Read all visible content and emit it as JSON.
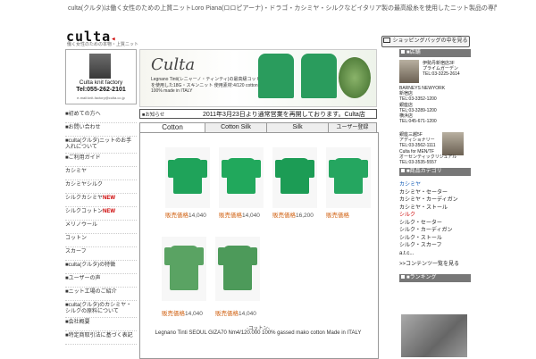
{
  "header": {
    "description": "culta(クルタ)は働く女性のための上質ニットLoro Piana(ロロピアーナ)・ドラゴ・カシミヤ・シルクなどイタリア製の最高級糸を使用したニット製品の専門店です。",
    "logo": "culta",
    "tagline": "働く女性のための本物・上質ニット",
    "cart_button": "ショッピングバッグの中を見る"
  },
  "factory": {
    "name": "Culta knit factory",
    "tel": "Tel:055-262-2101",
    "email": "e-mail:knit-factory@culta.co.jp"
  },
  "sidebar": {
    "items": [
      {
        "label": "■初めての方へ"
      },
      {
        "label": "■お問い合わせ"
      },
      {
        "label": "■culta(クルタ)ニットのお手入れについて"
      },
      {
        "label": "■ご利用ガイド"
      },
      {
        "label": "カシミヤ"
      },
      {
        "label": "カシミヤシルク"
      },
      {
        "label": "シルクカシミヤ",
        "badge": "NEW"
      },
      {
        "label": "シルクコットン",
        "badge": "NEW"
      },
      {
        "label": "メリノウール"
      },
      {
        "label": "コットン"
      },
      {
        "label": "スカーフ"
      },
      {
        "label": "■culta(クルタ)の特徴"
      },
      {
        "label": "■ユーザーの声"
      },
      {
        "label": "■ニット工場のご紹介"
      },
      {
        "label": "■culta(クルタ)のカシミヤ・シルクの原料について"
      },
      {
        "label": "■会社概要"
      },
      {
        "label": "■特定商取引法に基づく表記"
      }
    ]
  },
  "banner": {
    "title": "Culta",
    "text": "Legnano Tinti(レニャーノ・ティンティ)の最高級コットンを使用した18G・スキンニット 使用素材:4/120 cotton 100% made in ITALY"
  },
  "notice": {
    "label": "■お知らせ",
    "text": "2011年3月23日より通常営業を再開しております。Culta店"
  },
  "tabs": [
    {
      "label": "Cotton",
      "active": true
    },
    {
      "label": "Cotton Silk",
      "active": false
    },
    {
      "label": "Silk",
      "active": false
    },
    {
      "label": "ユーザー登録",
      "active": false
    }
  ],
  "products": [
    {
      "price_label": "販売価格",
      "price": "14,040",
      "color": "#1fa35a"
    },
    {
      "price_label": "販売価格",
      "price": "14,040",
      "color": "#21a85c"
    },
    {
      "price_label": "販売価格",
      "price": "16,200",
      "color": "#1c9c55"
    },
    {
      "price_label": "販売価格",
      "price": "",
      "color": "#25a660"
    },
    {
      "price_label": "販売価格",
      "price": "14,040",
      "color": "#5aa363"
    },
    {
      "price_label": "販売価格",
      "price": "14,040",
      "color": "#4d9a5a"
    }
  ],
  "caption": {
    "line1": "-コットン-",
    "line2": "Legnano Tinti SEOUL GIZA70 Nm4/120.000 100% gassed mako cotton Made in ITALY"
  },
  "right": {
    "store_head": "■店舗",
    "stores": [
      {
        "lines": [
          "伊勢丹新宿店3F",
          "プライムガーデン",
          "TEL:03-3225-2614"
        ]
      },
      {
        "lines": [
          "BARNEYS NEWYORK",
          "新宿店",
          "TEL:03-3352-1200",
          "銀座店",
          "TEL:03-3289-1200",
          "横浜店",
          "TEL:045-671-1200"
        ]
      },
      {
        "lines": [
          "銀座三越5F",
          "アディショナリー",
          "TEL:03-3562-1111",
          "Culta for MEN/TF",
          "オーセンティックリジュアル",
          "TEL:03-3535-5557"
        ]
      }
    ],
    "category_head": "■商品カテゴリ",
    "categories_blue": [
      "カシミヤ"
    ],
    "categories": [
      "カシミヤ・セーター",
      "カシミヤ・カーディガン",
      "カシミヤ・ストール"
    ],
    "categories_red": [
      "シルク"
    ],
    "categories_2": [
      "シルク・セーター",
      "シルク・カーディガン",
      "シルク・ストール",
      "シルク・スカーフ",
      "a.t.c..."
    ],
    "more": ">>コンテンツ一覧を見る",
    "ranking_head": "■ランキング"
  }
}
